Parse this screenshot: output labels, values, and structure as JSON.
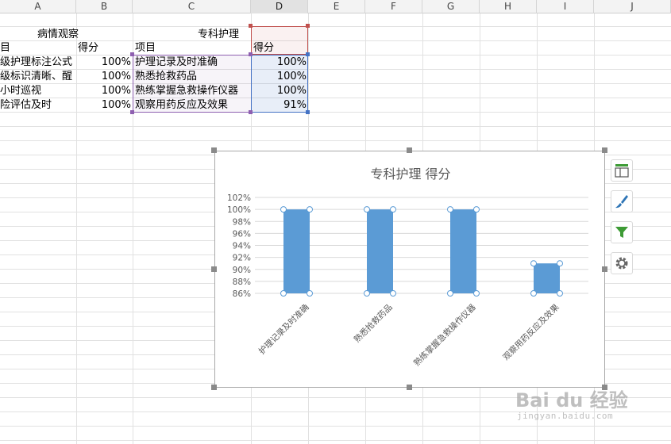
{
  "columns": [
    "A",
    "B",
    "C",
    "D",
    "E",
    "F",
    "G",
    "H",
    "I",
    "J"
  ],
  "sheet": {
    "left_table": {
      "title": "病情观察",
      "header_item": "目",
      "header_score": "得分",
      "rows": [
        {
          "item": "级护理标注公式",
          "score": "100%"
        },
        {
          "item": "级标识清晰、醒",
          "score": "100%"
        },
        {
          "item": "小时巡视",
          "score": "100%"
        },
        {
          "item": "险评估及时",
          "score": "100%"
        }
      ]
    },
    "right_table": {
      "title": "专科护理",
      "header_item": "项目",
      "header_score": "得分",
      "rows": [
        {
          "item": "护理记录及时准确",
          "score": "100%"
        },
        {
          "item": "熟悉抢救药品",
          "score": "100%"
        },
        {
          "item": "熟练掌握急救操作仪器",
          "score": "100%"
        },
        {
          "item": "观察用药反应及效果",
          "score": "91%"
        }
      ]
    }
  },
  "chart_data": {
    "type": "bar",
    "title": "专科护理 得分",
    "categories": [
      "护理记录及时准确",
      "熟悉抢救药品",
      "熟练掌握急救操作仪器",
      "观察用药反应及效果"
    ],
    "series": [
      {
        "values": [
          100,
          100,
          100,
          91
        ]
      }
    ],
    "ylim": [
      86,
      102
    ],
    "yticks": [
      "86%",
      "88%",
      "90%",
      "92%",
      "94%",
      "96%",
      "98%",
      "100%",
      "102%"
    ],
    "grid": true,
    "bar_color": "#5b9bd5"
  },
  "side_buttons": [
    {
      "icon": "chart-elements-icon"
    },
    {
      "icon": "chart-style-brush-icon"
    },
    {
      "icon": "chart-filter-icon"
    },
    {
      "icon": "chart-settings-gear-icon"
    }
  ],
  "watermark": {
    "logo": "Bai du 经验",
    "url": "jingyan.baidu.com"
  },
  "colors": {
    "selection_red": "#c0504d",
    "selection_purple": "#8e5fb0",
    "selection_blue": "#4472c4",
    "brush_icon": "#2e75b6",
    "filter_icon": "#3d9b35"
  }
}
